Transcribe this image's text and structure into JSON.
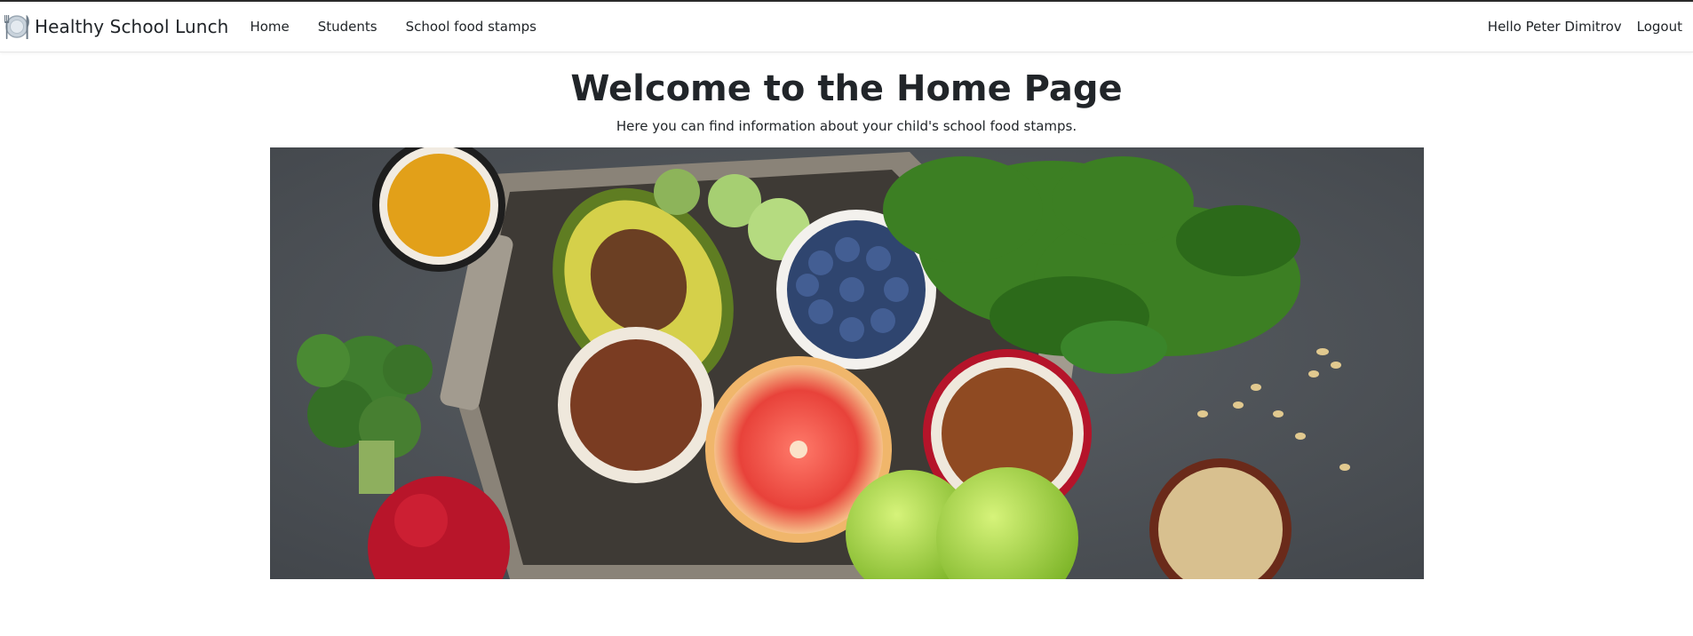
{
  "navbar": {
    "brand": "Healthy School Lunch",
    "links": [
      {
        "label": "Home"
      },
      {
        "label": "Students"
      },
      {
        "label": "School food stamps"
      }
    ],
    "greeting": "Hello Peter Dimitrov",
    "logout_label": "Logout"
  },
  "main": {
    "title": "Welcome to the Home Page",
    "subtitle": "Here you can find information about your child's school food stamps."
  },
  "icons": {
    "brand_logo": "plate-fork-knife-icon"
  },
  "colors": {
    "text": "#212529",
    "navbar_bg": "#ffffff",
    "top_border": "#2b2b2b",
    "hero_background": "#4f5358"
  }
}
